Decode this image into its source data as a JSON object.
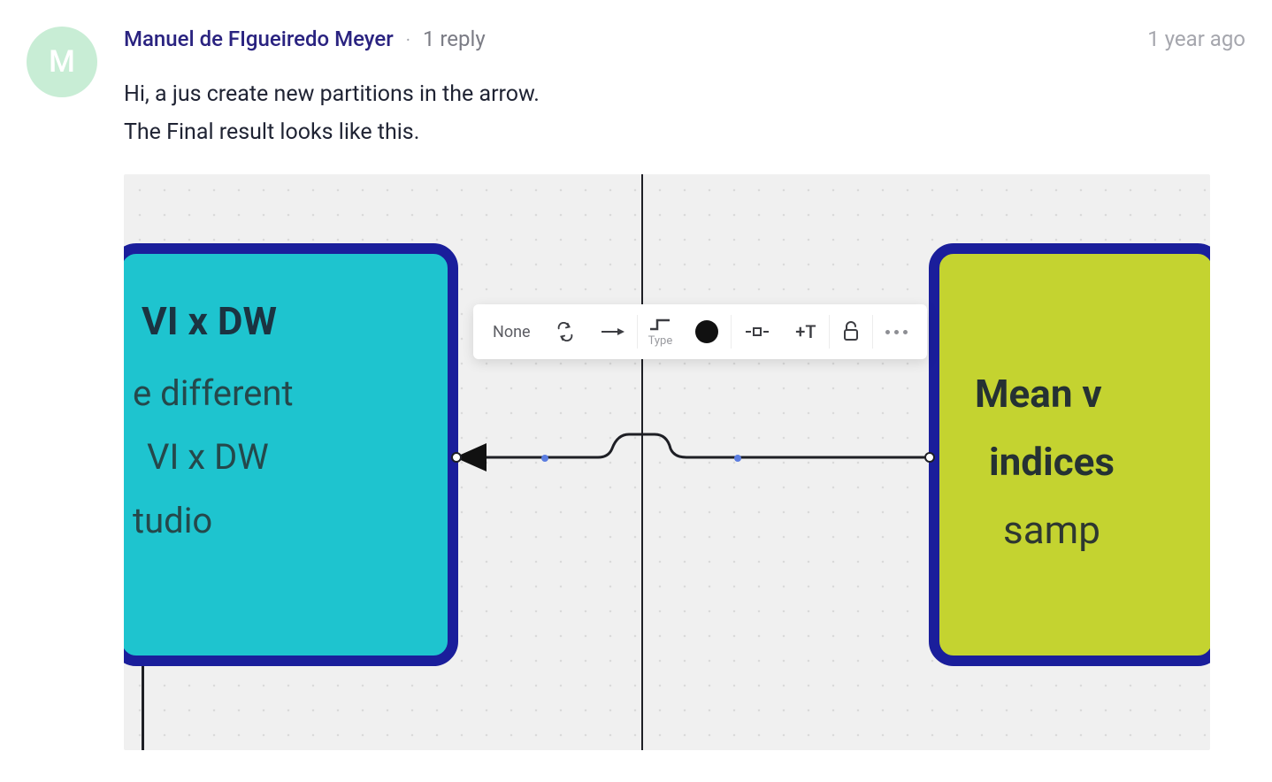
{
  "comment": {
    "avatar_initial": "M",
    "author": "Manuel de FIgueiredo Meyer",
    "separator": "·",
    "reply_count": "1 reply",
    "timestamp": "1 year ago",
    "body_line1": "Hi, a jus create new partitions in the arrow.",
    "body_line2": "The Final result looks like this."
  },
  "diagram": {
    "left_node": {
      "title": "VI x DW",
      "line2": "e different",
      "line3": "VI x DW",
      "line4": "tudio"
    },
    "right_node": {
      "line1": "Mean v",
      "line2": "indices",
      "line3": "samp"
    },
    "toolbar": {
      "none_label": "None",
      "type_label": "Type",
      "text_button": "+T"
    }
  }
}
